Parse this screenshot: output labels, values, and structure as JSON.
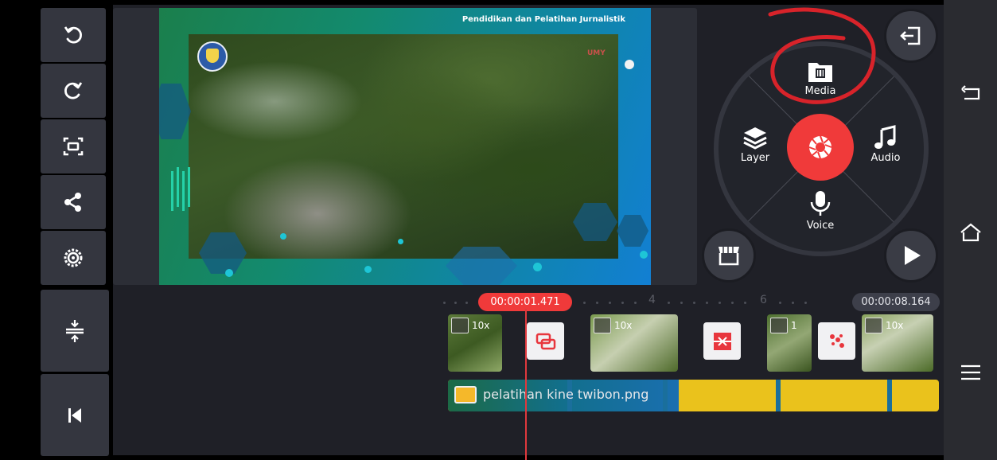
{
  "preview": {
    "header_text": "Pendidikan dan Pelatihan Jurnalistik",
    "watermark": "UMY"
  },
  "left_toolbar": {
    "items": [
      "undo-icon",
      "redo-icon",
      "fit-screen-icon",
      "share-icon",
      "settings-icon"
    ]
  },
  "radial_menu": {
    "media_label": "Media",
    "layer_label": "Layer",
    "audio_label": "Audio",
    "voice_label": "Voice",
    "accent": "#f03a3a"
  },
  "timeline": {
    "current_time": "00:00:01.471",
    "total_time": "00:00:08.164",
    "ruler_marks": [
      "4",
      "6"
    ],
    "clips": [
      {
        "speed": "10x"
      },
      {
        "speed": "10x"
      },
      {
        "speed": "1"
      },
      {
        "speed": "10x"
      }
    ],
    "layer_name": "pelatihan kine twibon.png",
    "layer_color": "#eac21c"
  },
  "colors": {
    "panel": "#34363f",
    "background": "#1f2027",
    "record": "#f03a3a"
  }
}
